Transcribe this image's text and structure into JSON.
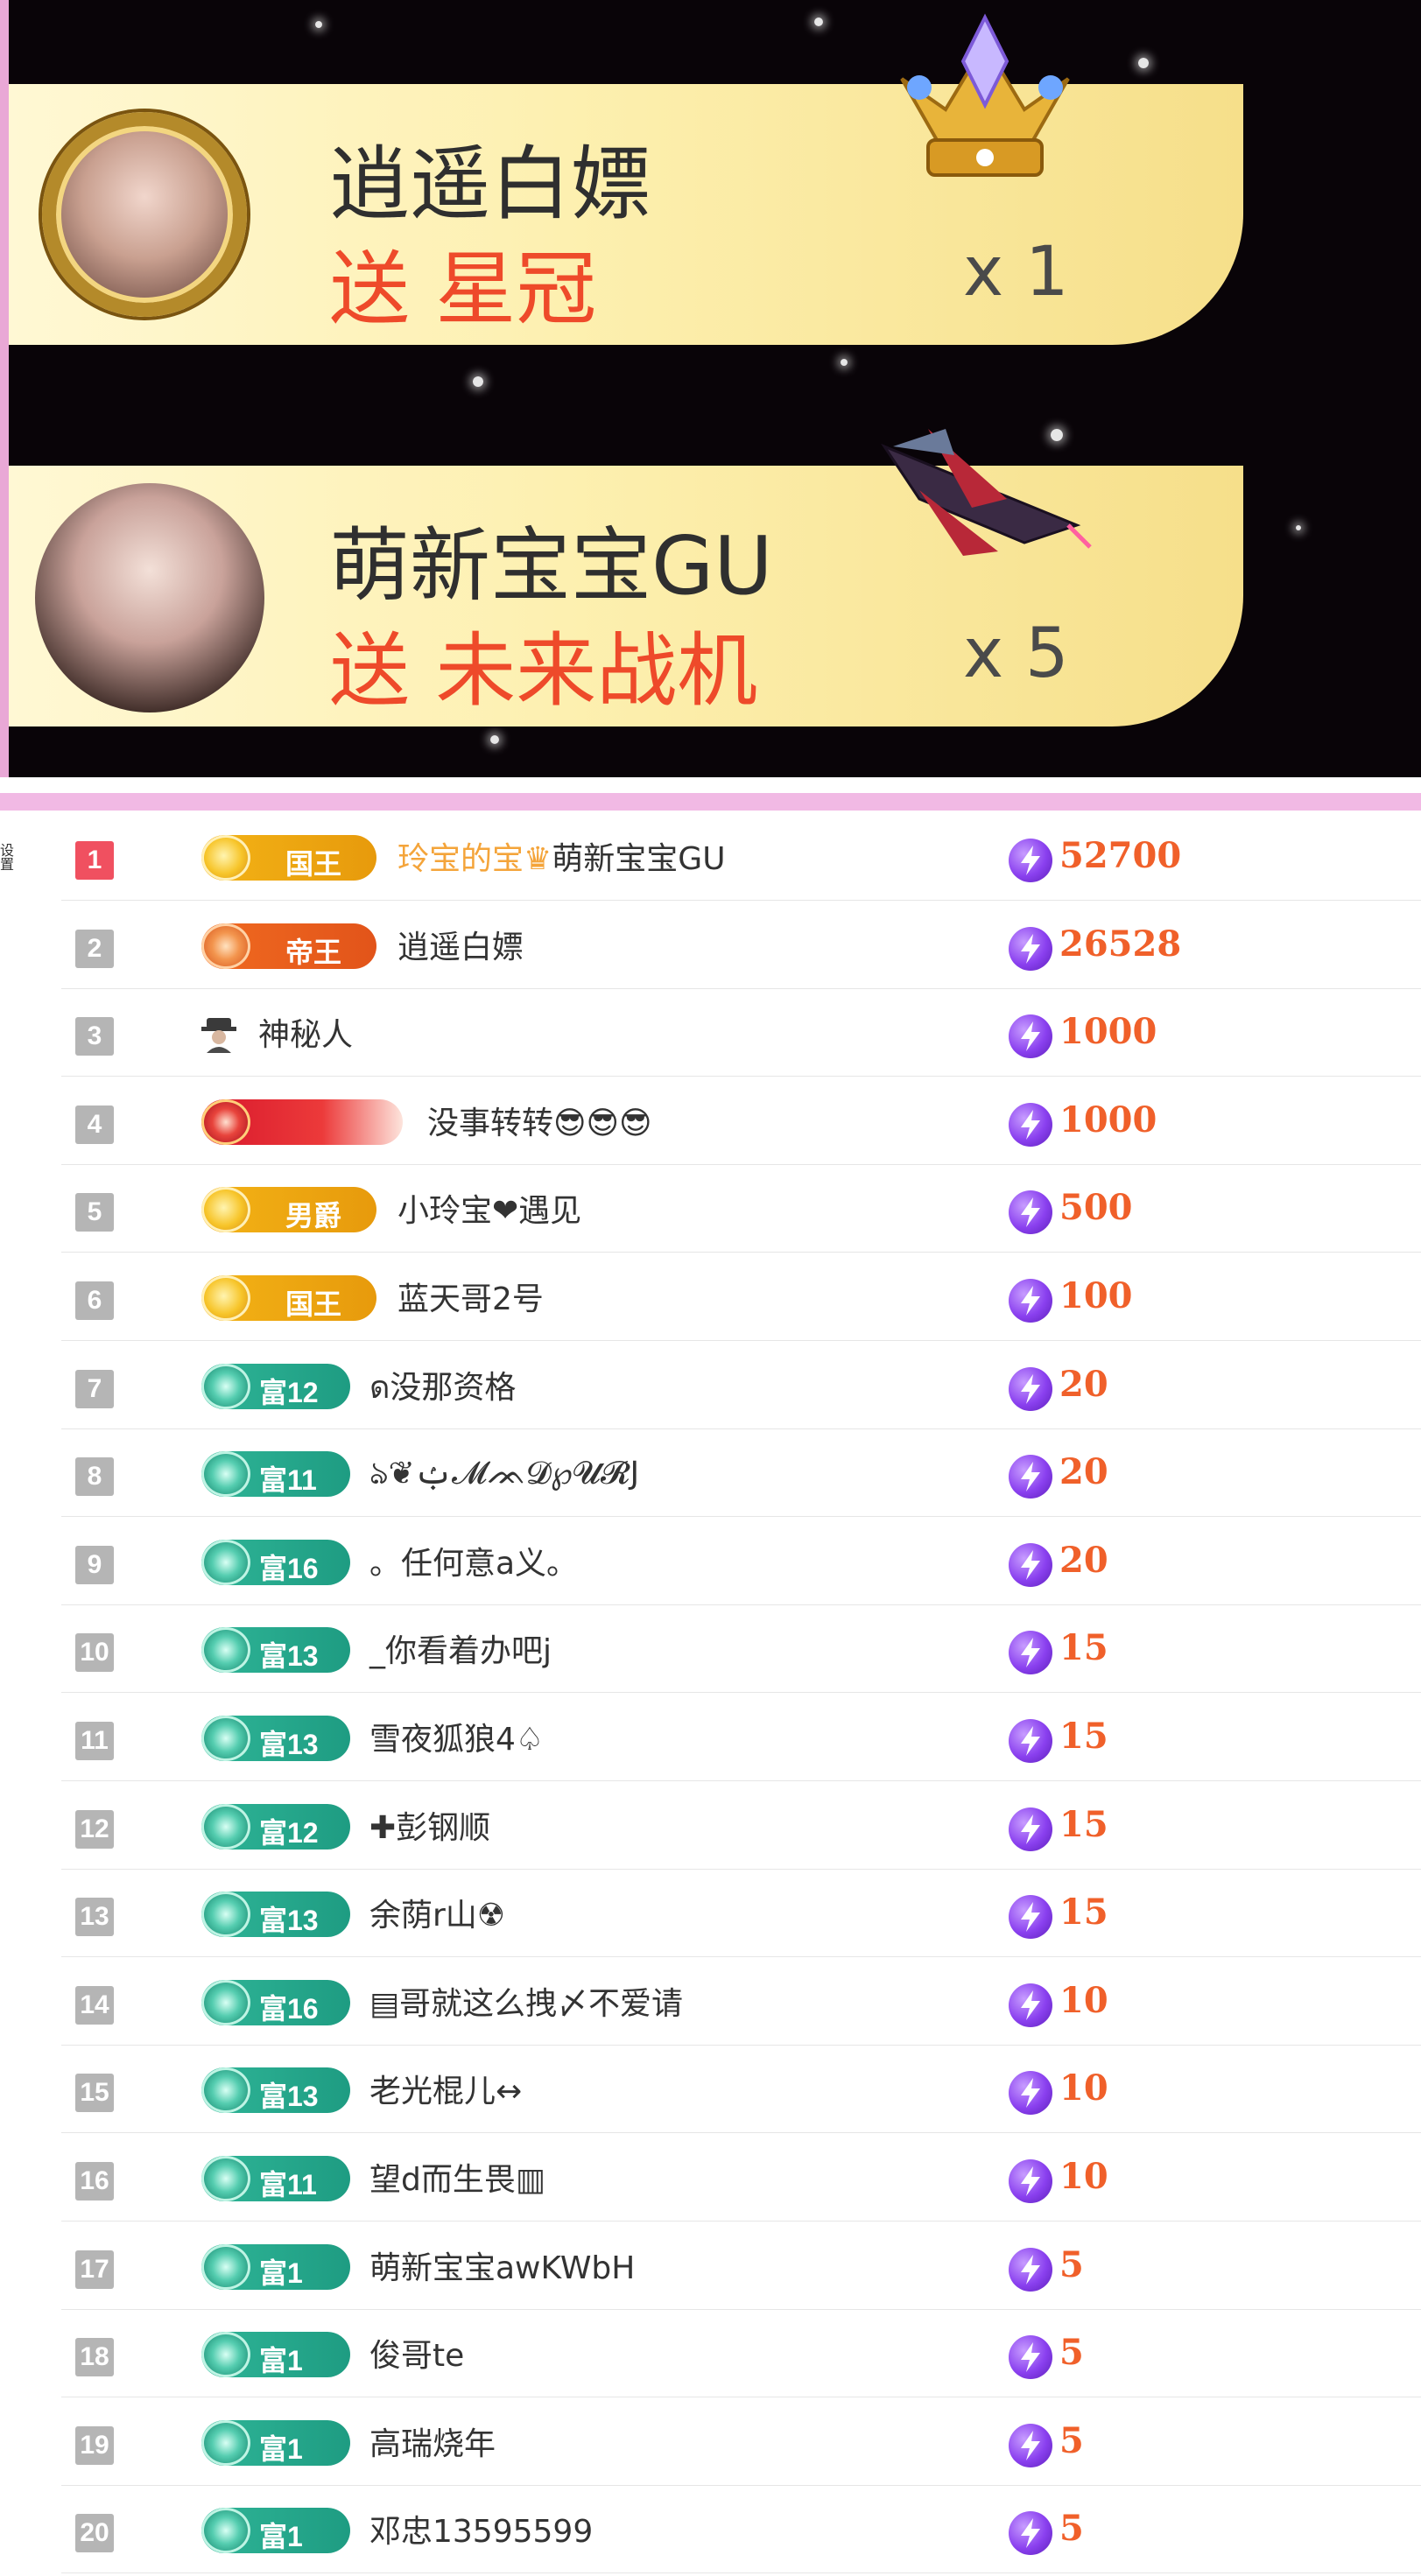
{
  "gifts": [
    {
      "sender": "逍遥白嫖",
      "gift_text": "送 星冠",
      "count": "x 1",
      "gift_icon": "crown-icon"
    },
    {
      "sender": "萌新宝宝GU",
      "gift_text": "送 未来战机",
      "count": "x 5",
      "gift_icon": "fighter-jet-icon"
    }
  ],
  "side_label": "设置",
  "ranking": [
    {
      "rank": "1",
      "badge": "gold",
      "level": "国王",
      "name_gold": "玲宝的宝",
      "name": "萌新宝宝GU",
      "score": "52700"
    },
    {
      "rank": "2",
      "badge": "orange",
      "level": "帝王",
      "name": "逍遥白嫖",
      "score": "26528"
    },
    {
      "rank": "3",
      "badge": "none",
      "level": "",
      "name": "神秘人",
      "score": "1000"
    },
    {
      "rank": "4",
      "badge": "red",
      "level": "",
      "name": "没事转转😎😎😎",
      "score": "1000"
    },
    {
      "rank": "5",
      "badge": "gold",
      "level": "男爵",
      "name": "小玲宝❤遇见",
      "score": "500"
    },
    {
      "rank": "6",
      "badge": "gold",
      "level": "国王",
      "name": "蓝天哥2号",
      "score": "100"
    },
    {
      "rank": "7",
      "badge": "teal",
      "level": "富12",
      "name": "ด没那资格",
      "score": "20"
    },
    {
      "rank": "8",
      "badge": "teal",
      "level": "富11",
      "name": "ঌ❦ࢶ𝓜ᨏ𝓓℘𝓤𝓡J",
      "score": "20"
    },
    {
      "rank": "9",
      "badge": "teal",
      "level": "富16",
      "name": "。任何意a义。",
      "score": "20"
    },
    {
      "rank": "10",
      "badge": "teal",
      "level": "富13",
      "name": "_你看着办吧j",
      "score": "15"
    },
    {
      "rank": "11",
      "badge": "teal",
      "level": "富13",
      "name": "雪夜狐狼4♤",
      "score": "15"
    },
    {
      "rank": "12",
      "badge": "teal",
      "level": "富12",
      "name": "✚彭钢顺",
      "score": "15"
    },
    {
      "rank": "13",
      "badge": "teal",
      "level": "富13",
      "name": "余荫r山☢",
      "score": "15"
    },
    {
      "rank": "14",
      "badge": "teal",
      "level": "富16",
      "name": "▤哥就这么拽〆不爱请",
      "score": "10"
    },
    {
      "rank": "15",
      "badge": "teal",
      "level": "富13",
      "name": "老光棍儿↔",
      "score": "10"
    },
    {
      "rank": "16",
      "badge": "teal",
      "level": "富11",
      "name": "望d而生畏▥",
      "score": "10"
    },
    {
      "rank": "17",
      "badge": "teal",
      "level": "富1",
      "name": "萌新宝宝awKWbH",
      "score": "5"
    },
    {
      "rank": "18",
      "badge": "teal",
      "level": "富1",
      "name": "俊哥te",
      "score": "5"
    },
    {
      "rank": "19",
      "badge": "teal",
      "level": "富1",
      "name": "高瑞烧年",
      "score": "5"
    },
    {
      "rank": "20",
      "badge": "teal",
      "level": "富1",
      "name": "邓忠13595599",
      "score": "5"
    }
  ],
  "colors": {
    "accent_pink": "#f1b9e4",
    "score_orange": "#f0602a",
    "coin_purple": "#8a40ef"
  }
}
